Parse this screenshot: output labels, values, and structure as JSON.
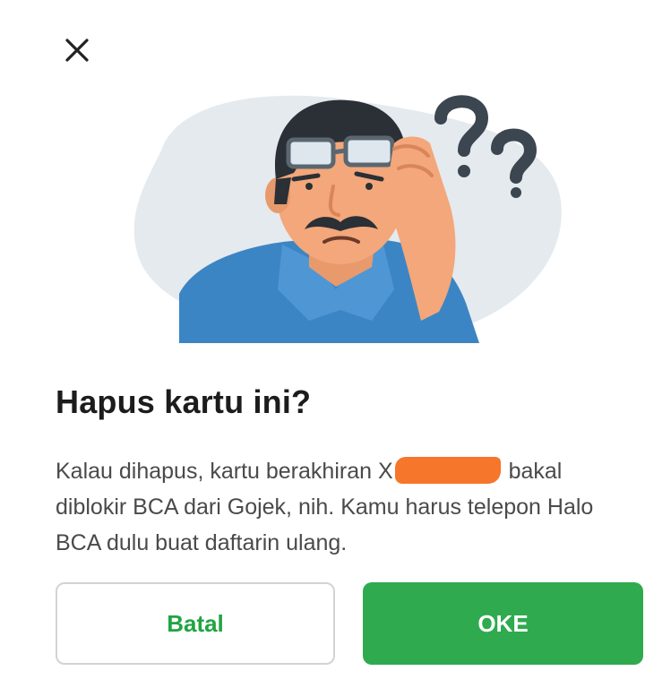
{
  "dialog": {
    "title": "Hapus kartu ini?",
    "message_part1": "Kalau dihapus, kartu berakhiran X",
    "message_part2": " bakal diblokir BCA dari Gojek, nih. Kamu harus telepon Halo BCA dulu buat daftarin ulang.",
    "cancel_label": "Batal",
    "ok_label": "OKE"
  },
  "icons": {
    "close": "close-icon",
    "illustration": "confused-man-illustration"
  },
  "colors": {
    "primary_green": "#2faa4f",
    "cancel_text_green": "#21a443",
    "redaction": "#f6762c"
  }
}
